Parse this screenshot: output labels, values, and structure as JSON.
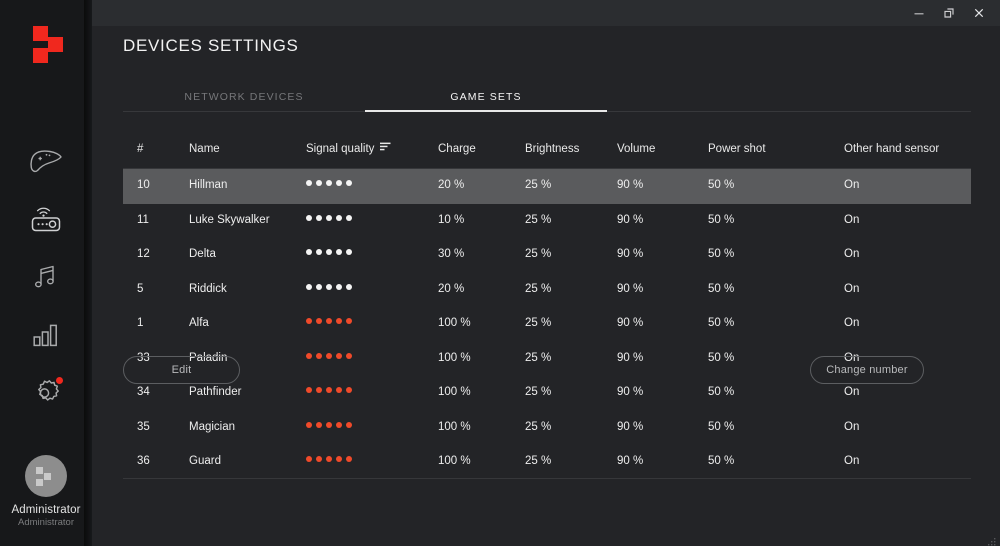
{
  "window": {
    "controls": [
      {
        "name": "minimize",
        "label": "Minimize"
      },
      {
        "name": "restore",
        "label": "Restore"
      },
      {
        "name": "close",
        "label": "Close"
      }
    ]
  },
  "theme": {
    "background": "#232427",
    "sidebar_background": "#17181a",
    "accent_red": "#f0281e",
    "signal_red": "#f04a2a",
    "signal_white": "#f4f4f4",
    "selected_row": "#5a5b5d",
    "text_primary": "#eeeeee",
    "text_muted": "#76777a",
    "divider": "#36373a"
  },
  "sidebar": {
    "logo": "app-logo",
    "items": [
      {
        "icon": "gamepad-icon",
        "label": "Game devices",
        "active": false,
        "badge": false
      },
      {
        "icon": "router-icon",
        "label": "Network devices",
        "active": false,
        "badge": false
      },
      {
        "icon": "music-note-icon",
        "label": "Audio",
        "active": false,
        "badge": false
      },
      {
        "icon": "bar-chart-icon",
        "label": "Statistics",
        "active": false,
        "badge": false
      },
      {
        "icon": "gear-icon",
        "label": "Settings",
        "active": true,
        "badge": true
      }
    ],
    "user": {
      "name": "Administrator",
      "role": "Administrator",
      "avatar": "avatar-logo"
    }
  },
  "header": {
    "title": "DEVICES SETTINGS"
  },
  "tabs": [
    {
      "label": "NETWORK DEVICES",
      "active": false
    },
    {
      "label": "GAME SETS",
      "active": true
    }
  ],
  "table": {
    "columns": [
      {
        "key": "num",
        "label": "#",
        "sort": false
      },
      {
        "key": "name",
        "label": "Name",
        "sort": false
      },
      {
        "key": "signal",
        "label": "Signal quality",
        "sort": true
      },
      {
        "key": "charge",
        "label": "Charge",
        "sort": false
      },
      {
        "key": "brightness",
        "label": "Brightness",
        "sort": false
      },
      {
        "key": "volume",
        "label": "Volume",
        "sort": false
      },
      {
        "key": "powershot",
        "label": "Power shot",
        "sort": false
      },
      {
        "key": "othersensor",
        "label": "Other hand sensor",
        "sort": false
      }
    ],
    "sort_icon": "sort-descending-icon",
    "rows": [
      {
        "num": "10",
        "name": "Hillman",
        "signal_dots": 5,
        "signal_color": "white",
        "charge": "20 %",
        "brightness": "25 %",
        "volume": "90 %",
        "powershot": "50 %",
        "othersensor": "On",
        "selected": true
      },
      {
        "num": "11",
        "name": "Luke Skywalker",
        "signal_dots": 5,
        "signal_color": "white",
        "charge": "10 %",
        "brightness": "25 %",
        "volume": "90 %",
        "powershot": "50 %",
        "othersensor": "On",
        "selected": false
      },
      {
        "num": "12",
        "name": "Delta",
        "signal_dots": 5,
        "signal_color": "white",
        "charge": "30 %",
        "brightness": "25 %",
        "volume": "90 %",
        "powershot": "50 %",
        "othersensor": "On",
        "selected": false
      },
      {
        "num": "5",
        "name": "Riddick",
        "signal_dots": 5,
        "signal_color": "white",
        "charge": "20 %",
        "brightness": "25 %",
        "volume": "90 %",
        "powershot": "50 %",
        "othersensor": "On",
        "selected": false
      },
      {
        "num": "1",
        "name": "Alfa",
        "signal_dots": 5,
        "signal_color": "red",
        "charge": "100 %",
        "brightness": "25 %",
        "volume": "90 %",
        "powershot": "50 %",
        "othersensor": "On",
        "selected": false
      },
      {
        "num": "33",
        "name": "Paladin",
        "signal_dots": 5,
        "signal_color": "red",
        "charge": "100 %",
        "brightness": "25 %",
        "volume": "90 %",
        "powershot": "50 %",
        "othersensor": "On",
        "selected": false
      },
      {
        "num": "34",
        "name": "Pathfinder",
        "signal_dots": 5,
        "signal_color": "red",
        "charge": "100 %",
        "brightness": "25 %",
        "volume": "90 %",
        "powershot": "50 %",
        "othersensor": "On",
        "selected": false
      },
      {
        "num": "35",
        "name": "Magician",
        "signal_dots": 5,
        "signal_color": "red",
        "charge": "100 %",
        "brightness": "25 %",
        "volume": "90 %",
        "powershot": "50 %",
        "othersensor": "On",
        "selected": false
      },
      {
        "num": "36",
        "name": "Guard",
        "signal_dots": 5,
        "signal_color": "red",
        "charge": "100 %",
        "brightness": "25 %",
        "volume": "90 %",
        "powershot": "50 %",
        "othersensor": "On",
        "selected": false
      }
    ],
    "column_x": [
      14,
      66,
      183,
      315,
      402,
      494,
      585,
      721
    ]
  },
  "footer": {
    "edit_label": "Edit",
    "change_number_label": "Change number"
  }
}
